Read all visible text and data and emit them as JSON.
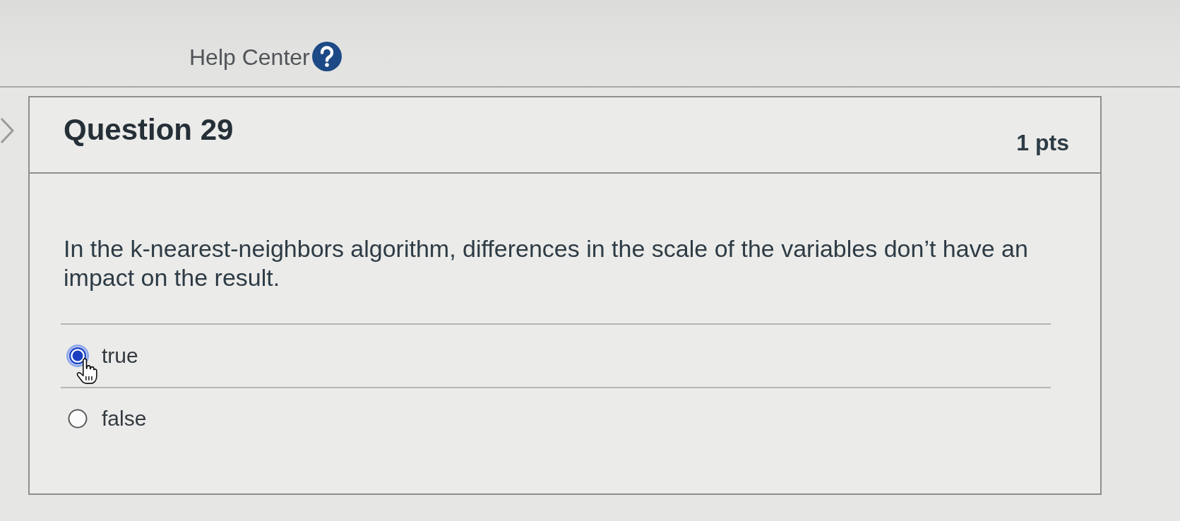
{
  "help_link": {
    "label": "Help Center"
  },
  "question": {
    "title": "Question 29",
    "points": "1 pts",
    "text": "In the k-nearest-neighbors algorithm, differences in the scale of the variables don’t have an impact on the result.",
    "answers": [
      {
        "label": "true",
        "selected": true
      },
      {
        "label": "false",
        "selected": false
      }
    ]
  }
}
